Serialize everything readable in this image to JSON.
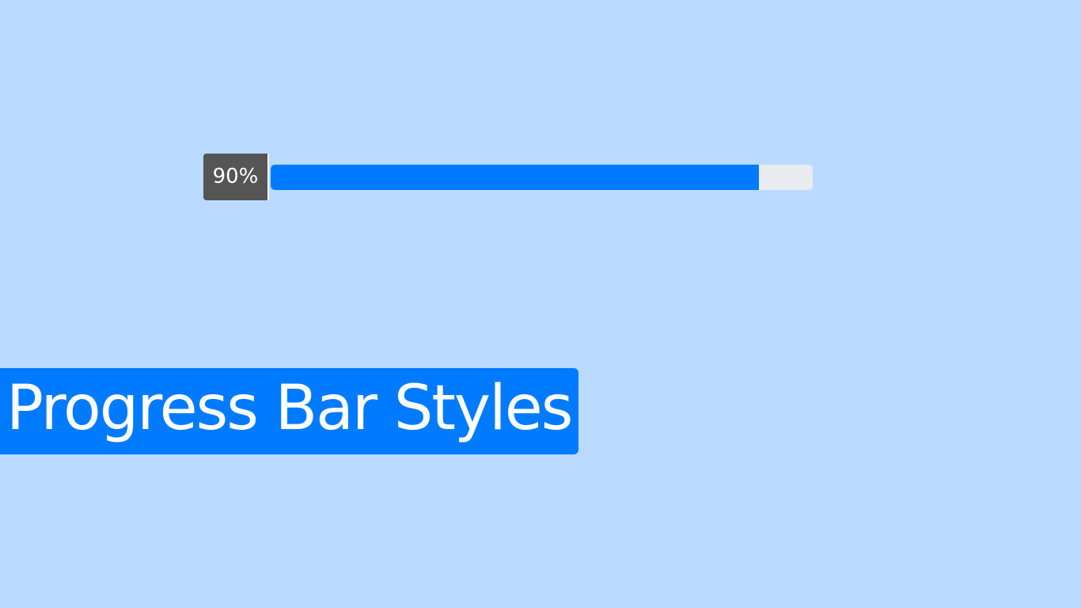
{
  "progress": {
    "label": "90%",
    "value_percent": 90
  },
  "title": {
    "text": "Progress Bar Styles"
  },
  "colors": {
    "background": "#badaff",
    "accent": "#007bff",
    "track": "#e9ecef",
    "badge": "#555555",
    "text_light": "#ffffff"
  }
}
